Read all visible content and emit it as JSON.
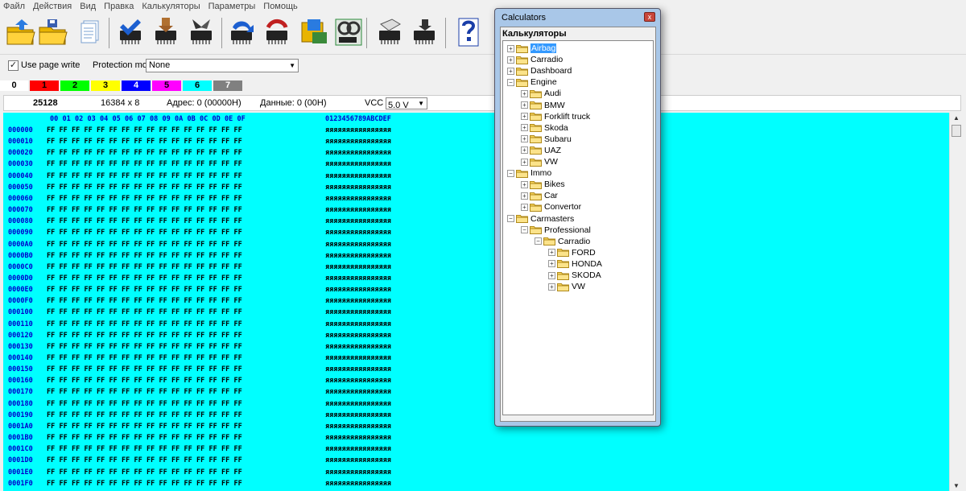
{
  "menu": [
    "Файл",
    "Действия",
    "Вид",
    "Правка",
    "Калькуляторы",
    "Параметры",
    "Помощь"
  ],
  "options": {
    "use_page_write_label": "Use page write",
    "use_page_write_checked": true,
    "protection_label": "Protection mode",
    "protection_value": "None"
  },
  "colors": [
    {
      "label": "0",
      "bg": "#ffffff",
      "fg": "#000000"
    },
    {
      "label": "1",
      "bg": "#ff0000",
      "fg": "#000000"
    },
    {
      "label": "2",
      "bg": "#00ff00",
      "fg": "#000000"
    },
    {
      "label": "3",
      "bg": "#ffff00",
      "fg": "#000000"
    },
    {
      "label": "4",
      "bg": "#0000ff",
      "fg": "#ffffff"
    },
    {
      "label": "5",
      "bg": "#ff00ff",
      "fg": "#000000"
    },
    {
      "label": "6",
      "bg": "#00ffff",
      "fg": "#000000"
    },
    {
      "label": "7",
      "bg": "#808080",
      "fg": "#ffffff"
    }
  ],
  "info": {
    "chip": "25128",
    "size": "16384 x 8",
    "address": "Адрес: 0 (00000H)",
    "data": "Данные: 0 (00H)",
    "vcc_label": "VCC",
    "vcc_value": "5.0 V"
  },
  "hex": {
    "columns": [
      "00",
      "01",
      "02",
      "03",
      "04",
      "05",
      "06",
      "07",
      "08",
      "09",
      "0A",
      "0B",
      "0C",
      "0D",
      "0E",
      "0F"
    ],
    "ascii_header": "0123456789ABCDEF",
    "byte_value": "FF",
    "ascii_value": "яяяяяяяяяяяяяяяя",
    "addresses": [
      "000000",
      "000010",
      "000020",
      "000030",
      "000040",
      "000050",
      "000060",
      "000070",
      "000080",
      "000090",
      "0000A0",
      "0000B0",
      "0000C0",
      "0000D0",
      "0000E0",
      "0000F0",
      "000100",
      "000110",
      "000120",
      "000130",
      "000140",
      "000150",
      "000160",
      "000170",
      "000180",
      "000190",
      "0001A0",
      "0001B0",
      "0001C0",
      "0001D0",
      "0001E0",
      "0001F0"
    ]
  },
  "dialog": {
    "title": "Calculators",
    "close": "x",
    "header": "Калькуляторы",
    "tree": [
      {
        "label": "Airbag",
        "depth": 0,
        "exp": "+",
        "selected": true
      },
      {
        "label": "Carradio",
        "depth": 0,
        "exp": "+"
      },
      {
        "label": "Dashboard",
        "depth": 0,
        "exp": "+"
      },
      {
        "label": "Engine",
        "depth": 0,
        "exp": "-"
      },
      {
        "label": "Audi",
        "depth": 1,
        "exp": "+"
      },
      {
        "label": "BMW",
        "depth": 1,
        "exp": "+"
      },
      {
        "label": "Forklift truck",
        "depth": 1,
        "exp": "+"
      },
      {
        "label": "Skoda",
        "depth": 1,
        "exp": "+"
      },
      {
        "label": "Subaru",
        "depth": 1,
        "exp": "+"
      },
      {
        "label": "UAZ",
        "depth": 1,
        "exp": "+"
      },
      {
        "label": "VW",
        "depth": 1,
        "exp": "+"
      },
      {
        "label": "Immo",
        "depth": 0,
        "exp": "-"
      },
      {
        "label": "Bikes",
        "depth": 1,
        "exp": "+"
      },
      {
        "label": "Car",
        "depth": 1,
        "exp": "+"
      },
      {
        "label": "Convertor",
        "depth": 1,
        "exp": "+"
      },
      {
        "label": "Carmasters",
        "depth": 0,
        "exp": "-"
      },
      {
        "label": "Professional",
        "depth": 1,
        "exp": "-"
      },
      {
        "label": "Carradio",
        "depth": 2,
        "exp": "-"
      },
      {
        "label": "FORD",
        "depth": 3,
        "exp": "+"
      },
      {
        "label": "HONDA",
        "depth": 3,
        "exp": "+"
      },
      {
        "label": "SKODA",
        "depth": 3,
        "exp": "+"
      },
      {
        "label": "VW",
        "depth": 3,
        "exp": "+"
      }
    ]
  },
  "toolbar_icons": [
    "open-icon",
    "save-icon",
    "document-icon",
    "chip-check-icon",
    "chip-read-icon",
    "chip-write-icon",
    "chip-auto-icon",
    "chip-verify-icon",
    "chip-blank-icon",
    "chip-compare-icon",
    "chip-erase-icon",
    "chip-id-icon",
    "help-icon"
  ]
}
